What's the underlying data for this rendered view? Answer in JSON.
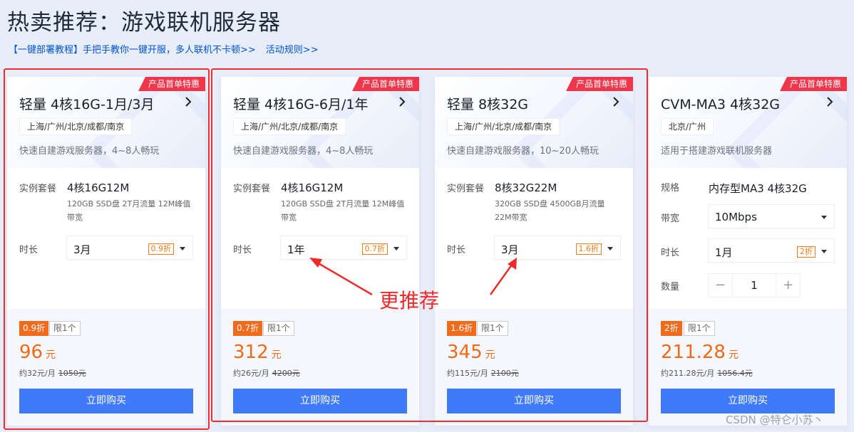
{
  "page": {
    "title": "热卖推荐：游戏联机服务器",
    "link_tutorial": "【一键部署教程】手把手教你一键开服，多人联机不卡顿>>",
    "link_rules": "活动规则>>"
  },
  "annotation": {
    "text": "更推荐"
  },
  "watermark": "CSDN @特仑小苏丶",
  "cards": [
    {
      "badge": "产品首单特惠",
      "title": "轻量 4核16G-1月/3月",
      "region": "上海/广州/北京/成都/南京",
      "desc": "快速自建游戏服务器，4~8人畅玩",
      "spec_label": "实例套餐",
      "spec_main": "4核16G12M",
      "spec_sub": "120GB SSD盘 2T月流量 12M峰值带宽",
      "duration_label": "时长",
      "duration_value": "3月",
      "duration_discount": "0.9折",
      "price_discount": "0.9折",
      "limit": "限1个",
      "price": "96",
      "price_unit": "元",
      "monthly": "约32元/月",
      "original": "1050元",
      "buy_label": "立即购买"
    },
    {
      "badge": "产品首单特惠",
      "title": "轻量 4核16G-6月/1年",
      "region": "上海/广州/北京/成都/南京",
      "desc": "快速自建游戏服务器，4~8人畅玩",
      "spec_label": "实例套餐",
      "spec_main": "4核16G12M",
      "spec_sub": "120GB SSD盘 2T月流量 12M峰值带宽",
      "duration_label": "时长",
      "duration_value": "1年",
      "duration_discount": "0.7折",
      "price_discount": "0.7折",
      "limit": "限1个",
      "price": "312",
      "price_unit": "元",
      "monthly": "约26元/月",
      "original": "4200元",
      "buy_label": "立即购买"
    },
    {
      "badge": "产品首单特惠",
      "title": "轻量 8核32G",
      "region": "上海/广州/北京/成都/南京",
      "desc": "快速自建游戏服务器，10~20人畅玩",
      "spec_label": "实例套餐",
      "spec_main": "8核32G22M",
      "spec_sub": "320GB SSD盘 4500GB月流量 22M带宽",
      "duration_label": "时长",
      "duration_value": "3月",
      "duration_discount": "1.6折",
      "price_discount": "1.6折",
      "limit": "限1个",
      "price": "345",
      "price_unit": "元",
      "monthly": "约115元/月",
      "original": "2100元",
      "buy_label": "立即购买"
    },
    {
      "badge": "产品首单特惠",
      "title": "CVM-MA3 4核32G",
      "region": "北京/广州",
      "desc": "适用于搭建游戏联机服务器",
      "spec_label": "规格",
      "spec_main": "内存型MA3 4核32G",
      "bandwidth_label": "带宽",
      "bandwidth_value": "10Mbps",
      "duration_label": "时长",
      "duration_value": "1月",
      "duration_discount": "2折",
      "qty_label": "数量",
      "qty_value": "1",
      "price_discount": "2折",
      "limit": "限1个",
      "price": "211.28",
      "price_unit": "元",
      "monthly": "约211.28元/月",
      "original": "1056.4元",
      "buy_label": "立即购买"
    }
  ],
  "colors": {
    "background": "#e7edf9",
    "accent_blue": "#3f7af9",
    "link_blue": "#0052d9",
    "badge_red": "#f0364a",
    "price_orange": "#ee6a19",
    "annotation_red": "#ef2f2f"
  }
}
